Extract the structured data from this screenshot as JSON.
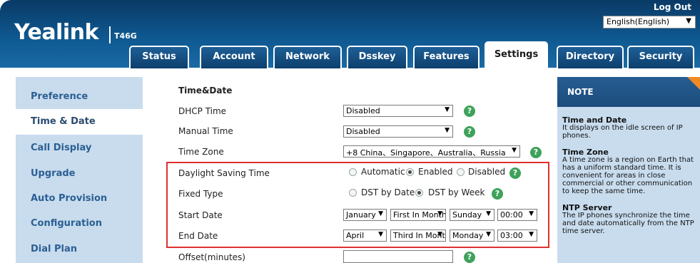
{
  "header": {
    "logo": "Yealink",
    "model": "T46G",
    "logout": "Log Out",
    "language": "English(English)"
  },
  "tabs": [
    {
      "label": "Status"
    },
    {
      "label": "Account"
    },
    {
      "label": "Network"
    },
    {
      "label": "Dsskey"
    },
    {
      "label": "Features"
    },
    {
      "label": "Settings",
      "active": true
    },
    {
      "label": "Directory"
    },
    {
      "label": "Security"
    }
  ],
  "sidebar": {
    "items": [
      {
        "label": "Preference"
      },
      {
        "label": "Time & Date",
        "active": true
      },
      {
        "label": "Call Display"
      },
      {
        "label": "Upgrade"
      },
      {
        "label": "Auto Provision"
      },
      {
        "label": "Configuration"
      },
      {
        "label": "Dial Plan"
      }
    ]
  },
  "main": {
    "section_title": "Time&Date",
    "dhcp_time": {
      "label": "DHCP Time",
      "value": "Disabled"
    },
    "manual_time": {
      "label": "Manual Time",
      "value": "Disabled"
    },
    "time_zone": {
      "label": "Time Zone",
      "value": "+8 China、Singapore、Australia、Russia"
    },
    "daylight_saving": {
      "label": "Daylight Saving Time",
      "options": [
        "Automatic",
        "Enabled",
        "Disabled"
      ],
      "selected": "Enabled"
    },
    "fixed_type": {
      "label": "Fixed Type",
      "options": [
        "DST by Date",
        "DST by Week"
      ],
      "selected": "DST by Week"
    },
    "start_date": {
      "label": "Start Date",
      "month": "January",
      "week": "First In Month",
      "day": "Sunday",
      "time": "00:00"
    },
    "end_date": {
      "label": "End Date",
      "month": "April",
      "week": "Third In Month",
      "day": "Monday",
      "time": "03:00"
    },
    "offset": {
      "label": "Offset(minutes)",
      "value": ""
    },
    "help_symbol": "?",
    "dropdown_arrow": "▼"
  },
  "note": {
    "title": "NOTE",
    "sections": [
      {
        "heading": "Time and Date",
        "text": "It displays on the idle screen of IP phones."
      },
      {
        "heading": "Time Zone",
        "text": "A time zone is a region on Earth that has a uniform standard time. It is convenient for areas in close commercial or other communication to keep the same time."
      },
      {
        "heading": "NTP Server",
        "text": "The IP phones synchronize the time and date automatically from the NTP time server."
      }
    ]
  },
  "colors": {
    "header_blue": "#0f5a93",
    "sidebar_bg": "#c8dcee",
    "help_green": "#3ea25a",
    "highlight_red": "#e03030",
    "note_corner": "#f08a24"
  }
}
